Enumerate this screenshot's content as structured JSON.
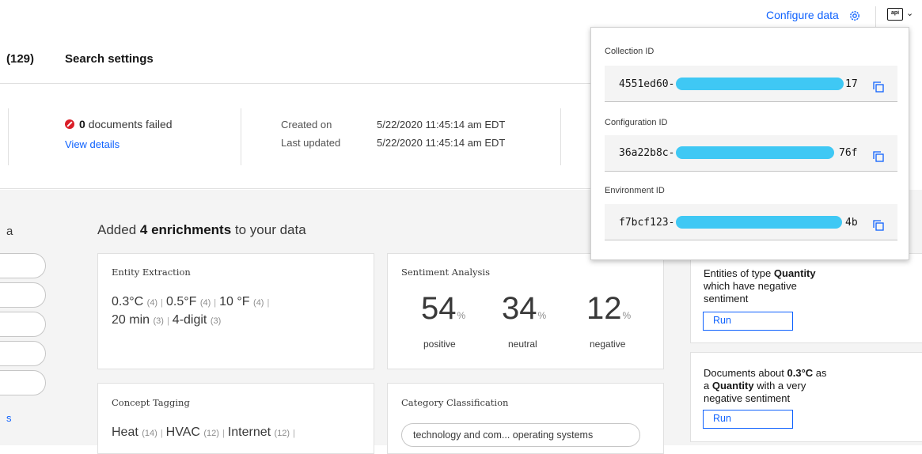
{
  "topbar": {
    "configure_label": "Configure data",
    "api_label": "api",
    "accent": "#0f62fe"
  },
  "tabs": {
    "count_fragment": "(129)",
    "search_settings": "Search settings"
  },
  "status": {
    "failed_count": "0",
    "failed_label": "documents failed",
    "view_details": "View details",
    "created_label": "Created on",
    "created_value": "5/22/2020 11:45:14 am EDT",
    "updated_label": "Last updated",
    "updated_value": "5/22/2020 11:45:14 am EDT",
    "error_color": "#da1e28"
  },
  "left_fragment": {
    "heading": "a",
    "link": "s"
  },
  "enrichments": {
    "prefix": "Added ",
    "count_bold": "4 enrichments",
    "suffix": " to your data"
  },
  "entity_card": {
    "title": "Entity Extraction",
    "entities": [
      {
        "name": "0.3°C",
        "count": "(4)"
      },
      {
        "name": "0.5°F",
        "count": "(4)"
      },
      {
        "name": "10 °F",
        "count": "(4)"
      },
      {
        "name": "20 min",
        "count": "(3)"
      },
      {
        "name": "4-digit",
        "count": "(3)"
      }
    ]
  },
  "sentiment_card": {
    "title": "Sentiment Analysis",
    "items": [
      {
        "value": "54",
        "unit": "%",
        "label": "positive"
      },
      {
        "value": "34",
        "unit": "%",
        "label": "neutral"
      },
      {
        "value": "12",
        "unit": "%",
        "label": "negative"
      }
    ]
  },
  "concept_card": {
    "title": "Concept Tagging",
    "concepts": [
      {
        "name": "Heat",
        "count": "(14)"
      },
      {
        "name": "HVAC",
        "count": "(12)"
      },
      {
        "name": "Internet",
        "count": "(12)"
      }
    ]
  },
  "category_card": {
    "title": "Category Classification",
    "chip": "technology and com... operating systems"
  },
  "queries": [
    {
      "t1": "Entities of type ",
      "b1": "Quantity",
      "t2": "",
      "b2": "",
      "t3": "which have negative",
      "t4": "sentiment",
      "run": "Run"
    },
    {
      "t1": "Documents about ",
      "b1": "0.3°C",
      "t2": " as",
      "t3a": "a ",
      "b2": "Quantity",
      "t3b": " with a very",
      "t4": "negative sentiment",
      "run": "Run"
    }
  ],
  "popover": {
    "collection_label": "Collection ID",
    "collection_value_start": "4551ed60-",
    "collection_value_end": "17",
    "configuration_label": "Configuration ID",
    "configuration_value_start": "36a22b8c-",
    "configuration_value_end": "76f",
    "environment_label": "Environment ID",
    "environment_value_start": "f7bcf123-",
    "environment_value_end": "4b",
    "redaction_color": "#3fc8f4"
  }
}
